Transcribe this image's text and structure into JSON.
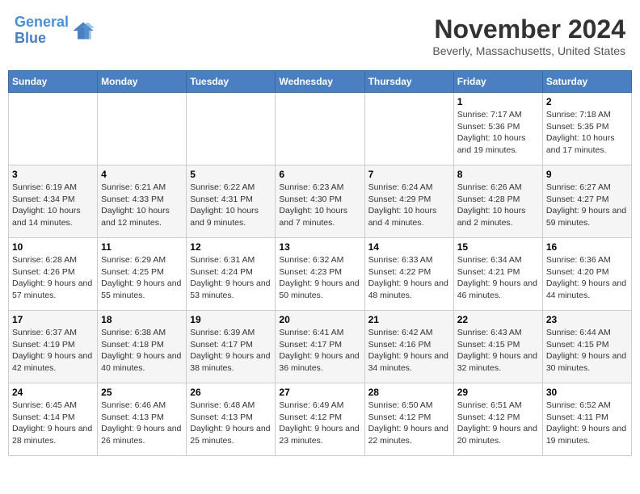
{
  "logo": {
    "line1": "General",
    "line2": "Blue"
  },
  "title": "November 2024",
  "location": "Beverly, Massachusetts, United States",
  "days_of_week": [
    "Sunday",
    "Monday",
    "Tuesday",
    "Wednesday",
    "Thursday",
    "Friday",
    "Saturday"
  ],
  "weeks": [
    [
      {
        "day": "",
        "info": ""
      },
      {
        "day": "",
        "info": ""
      },
      {
        "day": "",
        "info": ""
      },
      {
        "day": "",
        "info": ""
      },
      {
        "day": "",
        "info": ""
      },
      {
        "day": "1",
        "info": "Sunrise: 7:17 AM\nSunset: 5:36 PM\nDaylight: 10 hours and 19 minutes."
      },
      {
        "day": "2",
        "info": "Sunrise: 7:18 AM\nSunset: 5:35 PM\nDaylight: 10 hours and 17 minutes."
      }
    ],
    [
      {
        "day": "3",
        "info": "Sunrise: 6:19 AM\nSunset: 4:34 PM\nDaylight: 10 hours and 14 minutes."
      },
      {
        "day": "4",
        "info": "Sunrise: 6:21 AM\nSunset: 4:33 PM\nDaylight: 10 hours and 12 minutes."
      },
      {
        "day": "5",
        "info": "Sunrise: 6:22 AM\nSunset: 4:31 PM\nDaylight: 10 hours and 9 minutes."
      },
      {
        "day": "6",
        "info": "Sunrise: 6:23 AM\nSunset: 4:30 PM\nDaylight: 10 hours and 7 minutes."
      },
      {
        "day": "7",
        "info": "Sunrise: 6:24 AM\nSunset: 4:29 PM\nDaylight: 10 hours and 4 minutes."
      },
      {
        "day": "8",
        "info": "Sunrise: 6:26 AM\nSunset: 4:28 PM\nDaylight: 10 hours and 2 minutes."
      },
      {
        "day": "9",
        "info": "Sunrise: 6:27 AM\nSunset: 4:27 PM\nDaylight: 9 hours and 59 minutes."
      }
    ],
    [
      {
        "day": "10",
        "info": "Sunrise: 6:28 AM\nSunset: 4:26 PM\nDaylight: 9 hours and 57 minutes."
      },
      {
        "day": "11",
        "info": "Sunrise: 6:29 AM\nSunset: 4:25 PM\nDaylight: 9 hours and 55 minutes."
      },
      {
        "day": "12",
        "info": "Sunrise: 6:31 AM\nSunset: 4:24 PM\nDaylight: 9 hours and 53 minutes."
      },
      {
        "day": "13",
        "info": "Sunrise: 6:32 AM\nSunset: 4:23 PM\nDaylight: 9 hours and 50 minutes."
      },
      {
        "day": "14",
        "info": "Sunrise: 6:33 AM\nSunset: 4:22 PM\nDaylight: 9 hours and 48 minutes."
      },
      {
        "day": "15",
        "info": "Sunrise: 6:34 AM\nSunset: 4:21 PM\nDaylight: 9 hours and 46 minutes."
      },
      {
        "day": "16",
        "info": "Sunrise: 6:36 AM\nSunset: 4:20 PM\nDaylight: 9 hours and 44 minutes."
      }
    ],
    [
      {
        "day": "17",
        "info": "Sunrise: 6:37 AM\nSunset: 4:19 PM\nDaylight: 9 hours and 42 minutes."
      },
      {
        "day": "18",
        "info": "Sunrise: 6:38 AM\nSunset: 4:18 PM\nDaylight: 9 hours and 40 minutes."
      },
      {
        "day": "19",
        "info": "Sunrise: 6:39 AM\nSunset: 4:17 PM\nDaylight: 9 hours and 38 minutes."
      },
      {
        "day": "20",
        "info": "Sunrise: 6:41 AM\nSunset: 4:17 PM\nDaylight: 9 hours and 36 minutes."
      },
      {
        "day": "21",
        "info": "Sunrise: 6:42 AM\nSunset: 4:16 PM\nDaylight: 9 hours and 34 minutes."
      },
      {
        "day": "22",
        "info": "Sunrise: 6:43 AM\nSunset: 4:15 PM\nDaylight: 9 hours and 32 minutes."
      },
      {
        "day": "23",
        "info": "Sunrise: 6:44 AM\nSunset: 4:15 PM\nDaylight: 9 hours and 30 minutes."
      }
    ],
    [
      {
        "day": "24",
        "info": "Sunrise: 6:45 AM\nSunset: 4:14 PM\nDaylight: 9 hours and 28 minutes."
      },
      {
        "day": "25",
        "info": "Sunrise: 6:46 AM\nSunset: 4:13 PM\nDaylight: 9 hours and 26 minutes."
      },
      {
        "day": "26",
        "info": "Sunrise: 6:48 AM\nSunset: 4:13 PM\nDaylight: 9 hours and 25 minutes."
      },
      {
        "day": "27",
        "info": "Sunrise: 6:49 AM\nSunset: 4:12 PM\nDaylight: 9 hours and 23 minutes."
      },
      {
        "day": "28",
        "info": "Sunrise: 6:50 AM\nSunset: 4:12 PM\nDaylight: 9 hours and 22 minutes."
      },
      {
        "day": "29",
        "info": "Sunrise: 6:51 AM\nSunset: 4:12 PM\nDaylight: 9 hours and 20 minutes."
      },
      {
        "day": "30",
        "info": "Sunrise: 6:52 AM\nSunset: 4:11 PM\nDaylight: 9 hours and 19 minutes."
      }
    ]
  ]
}
